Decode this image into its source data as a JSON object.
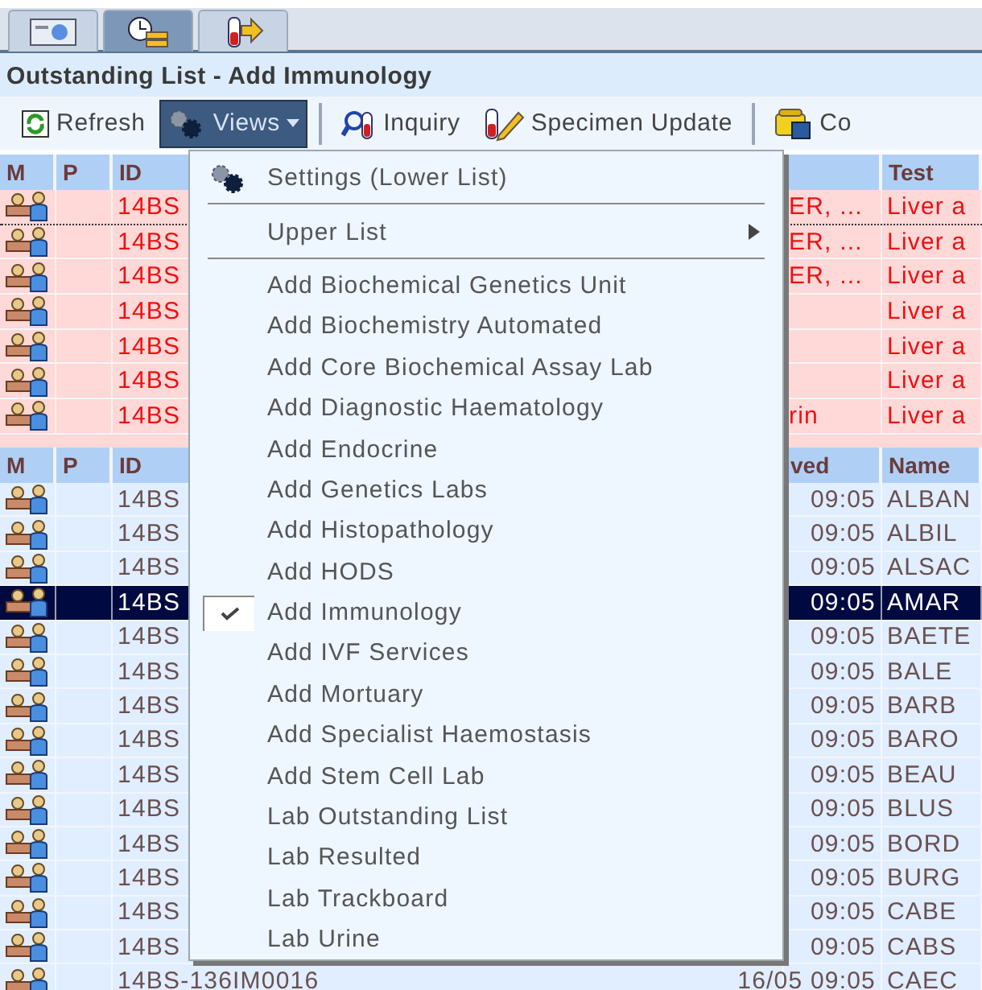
{
  "tabs": [
    {
      "selected": false
    },
    {
      "selected": true
    },
    {
      "selected": false
    }
  ],
  "title": "Outstanding List - Add Immunology",
  "toolbar": [
    {
      "kind": "button",
      "label": "Refresh",
      "open": false
    },
    {
      "kind": "dropdown",
      "label": "Views",
      "open": true
    },
    {
      "kind": "separator"
    },
    {
      "kind": "button",
      "label": "Inquiry",
      "open": false
    },
    {
      "kind": "button",
      "label": "Specimen Update",
      "open": false
    },
    {
      "kind": "separator"
    },
    {
      "kind": "button",
      "label": "Co",
      "open": false
    }
  ],
  "upper_table": {
    "columns": [
      "M",
      "P",
      "ID",
      "",
      "Test"
    ],
    "rows": [
      {
        "id": "14BS",
        "column_4": "ER, ...",
        "test": "Liver a",
        "focused": true
      },
      {
        "id": "14BS",
        "column_4": "ER, ...",
        "test": "Liver a",
        "focused": false
      },
      {
        "id": "14BS",
        "column_4": "ER, ...",
        "test": "Liver a",
        "focused": false
      },
      {
        "id": "14BS",
        "column_4": "",
        "test": "Liver a",
        "focused": false
      },
      {
        "id": "14BS",
        "column_4": "",
        "test": "Liver a",
        "focused": false
      },
      {
        "id": "14BS",
        "column_4": "",
        "test": "Liver a",
        "focused": false
      },
      {
        "id": "14BS",
        "column_4": "rin",
        "test": "Liver a",
        "focused": false
      }
    ]
  },
  "lower_table": {
    "columns": [
      "M",
      "P",
      "ID",
      "ved",
      "Name"
    ],
    "rows": [
      {
        "id": "14BS",
        "received": "09:05",
        "name": "ALBAN",
        "selected": false
      },
      {
        "id": "14BS",
        "received": "09:05",
        "name": "ALBIL",
        "selected": false
      },
      {
        "id": "14BS",
        "received": "09:05",
        "name": "ALSAC",
        "selected": false
      },
      {
        "id": "14BS",
        "received": "09:05",
        "name": "AMAR",
        "selected": true
      },
      {
        "id": "14BS",
        "received": "09:05",
        "name": "BAETE",
        "selected": false
      },
      {
        "id": "14BS",
        "received": "09:05",
        "name": "BALE",
        "selected": false
      },
      {
        "id": "14BS",
        "received": "09:05",
        "name": "BARB",
        "selected": false
      },
      {
        "id": "14BS",
        "received": "09:05",
        "name": "BARO",
        "selected": false
      },
      {
        "id": "14BS",
        "received": "09:05",
        "name": "BEAU",
        "selected": false
      },
      {
        "id": "14BS",
        "received": "09:05",
        "name": "BLUS",
        "selected": false
      },
      {
        "id": "14BS",
        "received": "09:05",
        "name": "BORD",
        "selected": false
      },
      {
        "id": "14BS",
        "received": "09:05",
        "name": "BURG",
        "selected": false
      },
      {
        "id": "14BS",
        "received": "09:05",
        "name": "CABE",
        "selected": false
      },
      {
        "id": "14BS",
        "received": "09:05",
        "name": "CABS",
        "selected": false
      },
      {
        "id": "14BS-136IM0016",
        "received": "16/05 09:05",
        "name": "CAEC",
        "selected": false
      }
    ]
  },
  "menu": {
    "sections": [
      {
        "items": [
          {
            "kind": "settings",
            "label": "Settings (Lower List)",
            "checked": false
          }
        ]
      },
      {
        "items": [
          {
            "kind": "submenu",
            "label": "Upper List",
            "checked": false
          }
        ]
      },
      {
        "items": [
          {
            "kind": "check",
            "label": "Add Biochemical Genetics Unit",
            "checked": false
          },
          {
            "kind": "check",
            "label": "Add Biochemistry Automated",
            "checked": false
          },
          {
            "kind": "check",
            "label": "Add Core Biochemical Assay Lab",
            "checked": false
          },
          {
            "kind": "check",
            "label": "Add Diagnostic Haematology",
            "checked": false
          },
          {
            "kind": "check",
            "label": "Add Endocrine",
            "checked": false
          },
          {
            "kind": "check",
            "label": "Add Genetics Labs",
            "checked": false
          },
          {
            "kind": "check",
            "label": "Add Histopathology",
            "checked": false
          },
          {
            "kind": "check",
            "label": "Add HODS",
            "checked": false
          },
          {
            "kind": "check",
            "label": "Add Immunology",
            "checked": true
          },
          {
            "kind": "check",
            "label": "Add IVF Services",
            "checked": false
          },
          {
            "kind": "check",
            "label": "Add Mortuary",
            "checked": false
          },
          {
            "kind": "check",
            "label": "Add Specialist Haemostasis",
            "checked": false
          },
          {
            "kind": "check",
            "label": "Add Stem Cell Lab",
            "checked": false
          },
          {
            "kind": "check",
            "label": "Lab Outstanding List",
            "checked": false
          },
          {
            "kind": "check",
            "label": "Lab Resulted",
            "checked": false
          },
          {
            "kind": "check",
            "label": "Lab Trackboard",
            "checked": false
          },
          {
            "kind": "check",
            "label": "Lab Urine",
            "checked": false
          }
        ]
      }
    ]
  }
}
